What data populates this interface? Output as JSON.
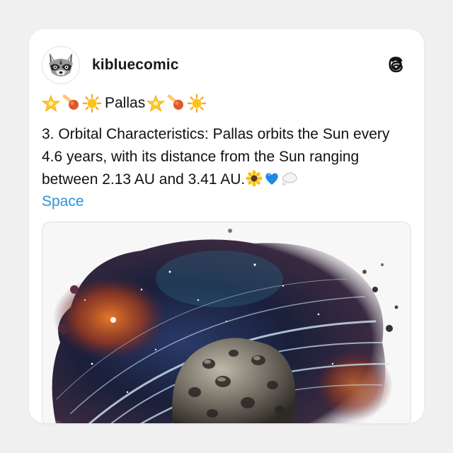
{
  "post": {
    "username": "kibluecomic",
    "title_word": "Pallas",
    "title_emojis": [
      "star-emoji",
      "comet-emoji",
      "sun-emoji",
      "star-emoji",
      "comet-emoji",
      "sun-emoji"
    ],
    "body_text": "3. Orbital Characteristics: Pallas orbits the Sun every 4.6 years, with its distance from the Sun ranging between 2.13 AU and 3.41 AU.",
    "body_trailing_emojis": [
      "sunflower-emoji",
      "blue-heart-emoji",
      "thought-bubble-emoji"
    ],
    "tag": "Space",
    "media_alt_icon": "asteroid-space-illustration"
  },
  "colors": {
    "background": "#f0f0f0",
    "card": "#ffffff",
    "tag_link": "#2a93d5",
    "text": "#111111"
  }
}
